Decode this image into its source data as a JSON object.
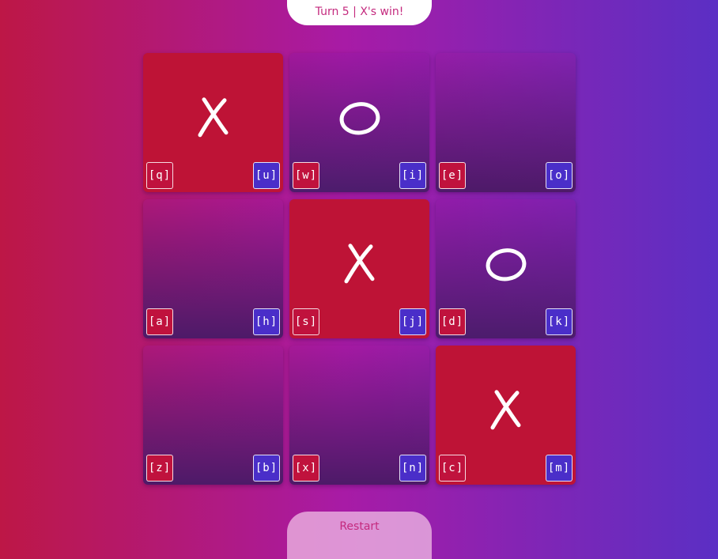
{
  "status": {
    "text": "Turn 5 | X's win!"
  },
  "restart": {
    "label": "Restart"
  },
  "colors": {
    "x_cell": "#be1336",
    "x_key": "#c0123d",
    "o_key": "#4a2ec9",
    "background_left": "#bd1746",
    "background_right": "#5b2fc4"
  },
  "board": {
    "cells": [
      {
        "mark": "X",
        "x_key": "[q]",
        "o_key": "[u]"
      },
      {
        "mark": "O",
        "x_key": "[w]",
        "o_key": "[i]"
      },
      {
        "mark": "",
        "x_key": "[e]",
        "o_key": "[o]"
      },
      {
        "mark": "",
        "x_key": "[a]",
        "o_key": "[h]"
      },
      {
        "mark": "X",
        "x_key": "[s]",
        "o_key": "[j]"
      },
      {
        "mark": "O",
        "x_key": "[d]",
        "o_key": "[k]"
      },
      {
        "mark": "",
        "x_key": "[z]",
        "o_key": "[b]"
      },
      {
        "mark": "",
        "x_key": "[x]",
        "o_key": "[n]"
      },
      {
        "mark": "X",
        "x_key": "[c]",
        "o_key": "[m]"
      }
    ]
  }
}
